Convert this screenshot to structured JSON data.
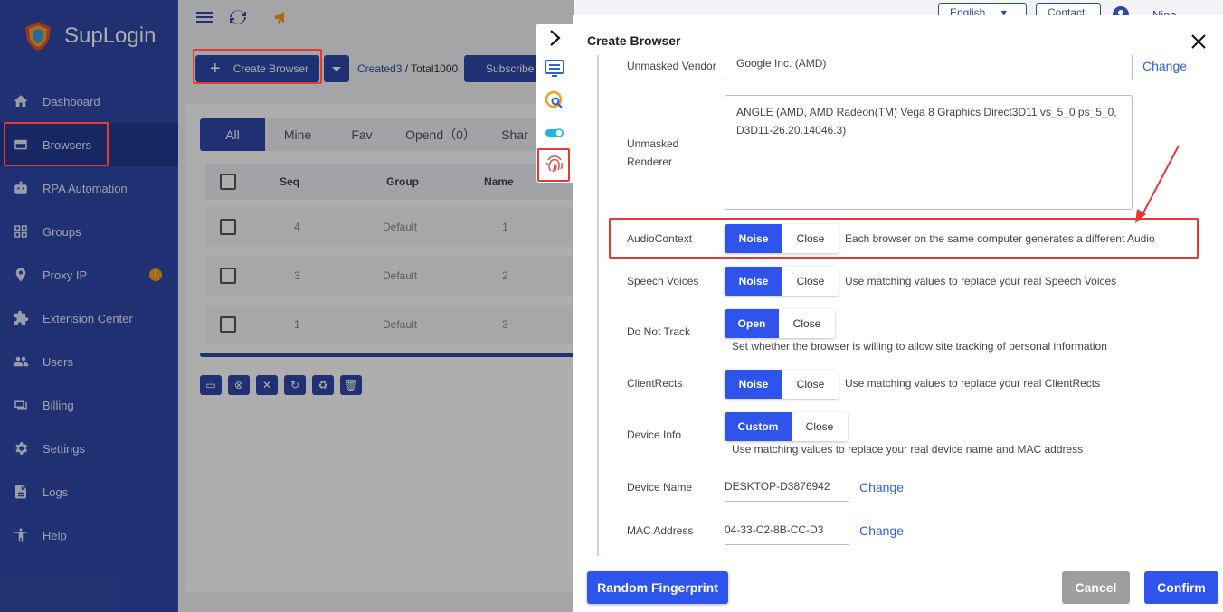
{
  "app": {
    "name": "SupLogin"
  },
  "sidebar": {
    "items": [
      {
        "label": "Dashboard",
        "icon": "home-icon"
      },
      {
        "label": "Browsers",
        "icon": "browser-icon"
      },
      {
        "label": "RPA Automation",
        "icon": "robot-icon"
      },
      {
        "label": "Groups",
        "icon": "grid-icon"
      },
      {
        "label": "Proxy IP",
        "icon": "location-pin-icon",
        "badge": "!"
      },
      {
        "label": "Extension Center",
        "icon": "puzzle-icon"
      },
      {
        "label": "Users",
        "icon": "users-icon"
      },
      {
        "label": "Billing",
        "icon": "billing-icon"
      },
      {
        "label": "Settings",
        "icon": "gear-icon"
      },
      {
        "label": "Logs",
        "icon": "document-icon"
      },
      {
        "label": "Help",
        "icon": "accessibility-icon"
      }
    ]
  },
  "topbar": {
    "language": "English",
    "contact": "Contact",
    "user": "Nina"
  },
  "toolbar": {
    "create_label": "Create Browser",
    "created": "Created3",
    "total": " / Total1000",
    "subscribe_label": "Subscribe"
  },
  "tabs": [
    "All",
    "Mine",
    "Fav",
    "Opend（0）",
    "Shar"
  ],
  "table": {
    "headers": [
      "Seq",
      "Group",
      "Name"
    ],
    "rows": [
      {
        "seq": "4",
        "group": "Default",
        "name": "1"
      },
      {
        "seq": "3",
        "group": "Default",
        "name": "2"
      },
      {
        "seq": "1",
        "group": "Default",
        "name": "3"
      }
    ]
  },
  "dialog": {
    "title": "Create Browser",
    "fields": {
      "vendor_label": "Unmasked Vendor",
      "vendor_value": "Google Inc. (AMD)",
      "vendor_change": "Change",
      "renderer_label": "Unmasked\nRenderer",
      "renderer_value": "ANGLE (AMD, AMD Radeon(TM) Vega 8 Graphics Direct3D11 vs_5_0 ps_5_0, D3D11-26.20.14046.3)",
      "audio_label": "AudioContext",
      "audio_on": "Noise",
      "audio_off": "Close",
      "audio_desc": "Each browser on the same computer generates a different Audio",
      "speech_label": "Speech Voices",
      "speech_on": "Noise",
      "speech_off": "Close",
      "speech_desc": "Use matching values to replace your real Speech Voices",
      "dnt_label": "Do Not Track",
      "dnt_on": "Open",
      "dnt_off": "Close",
      "dnt_desc": "Set whether the browser is willing to allow site tracking of personal information",
      "rects_label": "ClientRects",
      "rects_on": "Noise",
      "rects_off": "Close",
      "rects_desc": "Use matching values to replace your real ClientRects",
      "device_label": "Device Info",
      "device_on": "Custom",
      "device_off": "Close",
      "device_desc": "Use matching values to replace your real device name and MAC address",
      "devname_label": "Device Name",
      "devname_value": "DESKTOP-D3876942",
      "devname_change": "Change",
      "mac_label": "MAC Address",
      "mac_value": "04-33-C2-8B-CC-D3",
      "mac_change": "Change"
    },
    "footer": {
      "random": "Random Fingerprint",
      "cancel": "Cancel",
      "confirm": "Confirm"
    }
  },
  "colors": {
    "sidebar": "#2f49a8",
    "primary": "#2f54eb",
    "highlight": "#e53935",
    "link": "#2f62d6"
  }
}
